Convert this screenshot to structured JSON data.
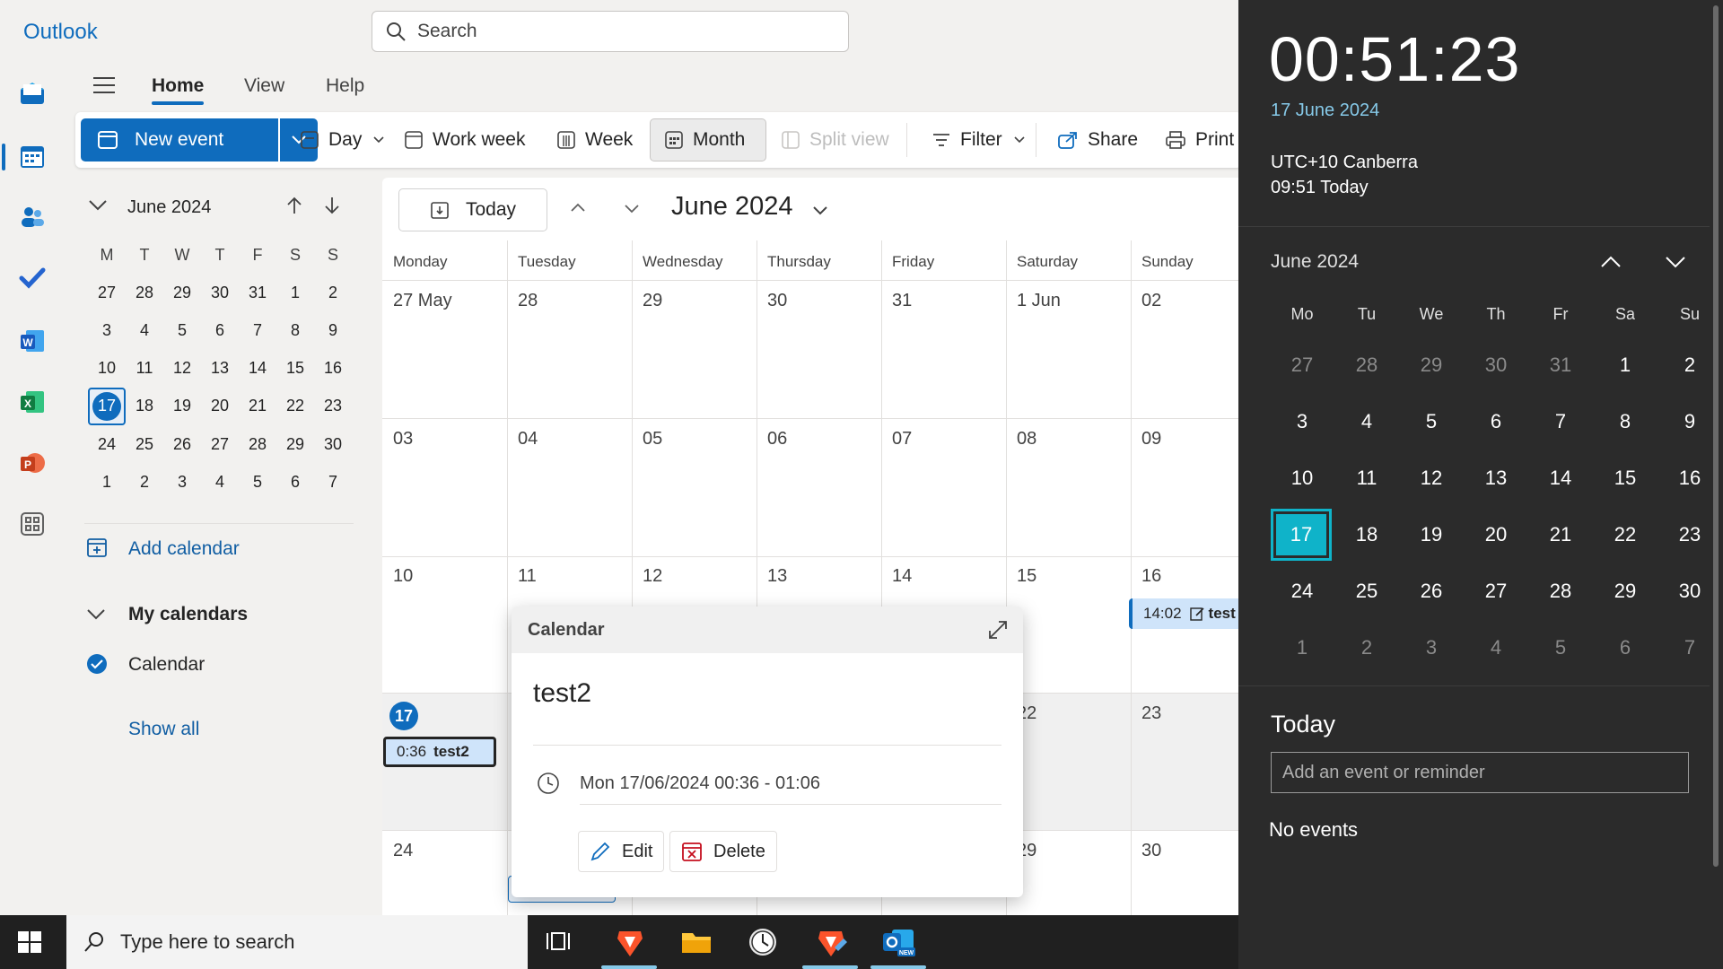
{
  "app": {
    "brand": "Outlook"
  },
  "search": {
    "placeholder": "Search"
  },
  "tabs": {
    "home": "Home",
    "view": "View",
    "help": "Help"
  },
  "ribbon": {
    "new_event": "New event",
    "day": "Day",
    "work_week": "Work week",
    "week": "Week",
    "month": "Month",
    "split_view": "Split view",
    "filter": "Filter",
    "share": "Share",
    "print": "Print"
  },
  "mini_calendar": {
    "title": "June 2024",
    "weekday_headers": [
      "M",
      "T",
      "W",
      "T",
      "F",
      "S",
      "S"
    ],
    "weeks": [
      [
        "27",
        "28",
        "29",
        "30",
        "31",
        "1",
        "2"
      ],
      [
        "3",
        "4",
        "5",
        "6",
        "7",
        "8",
        "9"
      ],
      [
        "10",
        "11",
        "12",
        "13",
        "14",
        "15",
        "16"
      ],
      [
        "17",
        "18",
        "19",
        "20",
        "21",
        "22",
        "23"
      ],
      [
        "24",
        "25",
        "26",
        "27",
        "28",
        "29",
        "30"
      ],
      [
        "1",
        "2",
        "3",
        "4",
        "5",
        "6",
        "7"
      ]
    ],
    "today": "17"
  },
  "left_nav": {
    "add_calendar": "Add calendar",
    "my_calendars": "My calendars",
    "calendar_item": "Calendar",
    "show_all": "Show all"
  },
  "calendar": {
    "today_button": "Today",
    "month_title": "June 2024",
    "day_names": [
      "Monday",
      "Tuesday",
      "Wednesday",
      "Thursday",
      "Friday",
      "Saturday",
      "Sunday"
    ],
    "weeks": [
      [
        "27 May",
        "28",
        "29",
        "30",
        "31",
        "1 Jun",
        "02"
      ],
      [
        "03",
        "04",
        "05",
        "06",
        "07",
        "08",
        "09"
      ],
      [
        "10",
        "11",
        "12",
        "13",
        "14",
        "15",
        "16"
      ],
      [
        "17",
        "",
        "",
        "",
        "",
        "22",
        "23"
      ],
      [
        "24",
        "",
        "",
        "",
        "",
        "29",
        "30"
      ]
    ],
    "events": {
      "test2": {
        "time": "0:36",
        "title": "test2"
      },
      "test": {
        "time": "14:02",
        "title": "test"
      }
    }
  },
  "popup": {
    "header": "Calendar",
    "title": "test2",
    "time": "Mon 17/06/2024 00:36 - 01:06",
    "edit": "Edit",
    "delete": "Delete"
  },
  "taskbar": {
    "search_placeholder": "Type here to search"
  },
  "flyout": {
    "clock": "00:51:23",
    "date": "17 June 2024",
    "timezone": "UTC+10 Canberra",
    "tz_time": "09:51 Today",
    "month_title": "June 2024",
    "weekday_headers": [
      "Mo",
      "Tu",
      "We",
      "Th",
      "Fr",
      "Sa",
      "Su"
    ],
    "weeks": [
      [
        "27",
        "28",
        "29",
        "30",
        "31",
        "1",
        "2"
      ],
      [
        "3",
        "4",
        "5",
        "6",
        "7",
        "8",
        "9"
      ],
      [
        "10",
        "11",
        "12",
        "13",
        "14",
        "15",
        "16"
      ],
      [
        "17",
        "18",
        "19",
        "20",
        "21",
        "22",
        "23"
      ],
      [
        "24",
        "25",
        "26",
        "27",
        "28",
        "29",
        "30"
      ],
      [
        "1",
        "2",
        "3",
        "4",
        "5",
        "6",
        "7"
      ]
    ],
    "selected": "17",
    "today_label": "Today",
    "add_placeholder": "Add an event or reminder",
    "no_events": "No events"
  },
  "colors": {
    "accent": "#0f6cbd",
    "flyout_accent": "#0fb3c9",
    "flyout_bg": "#2b2b2b"
  }
}
